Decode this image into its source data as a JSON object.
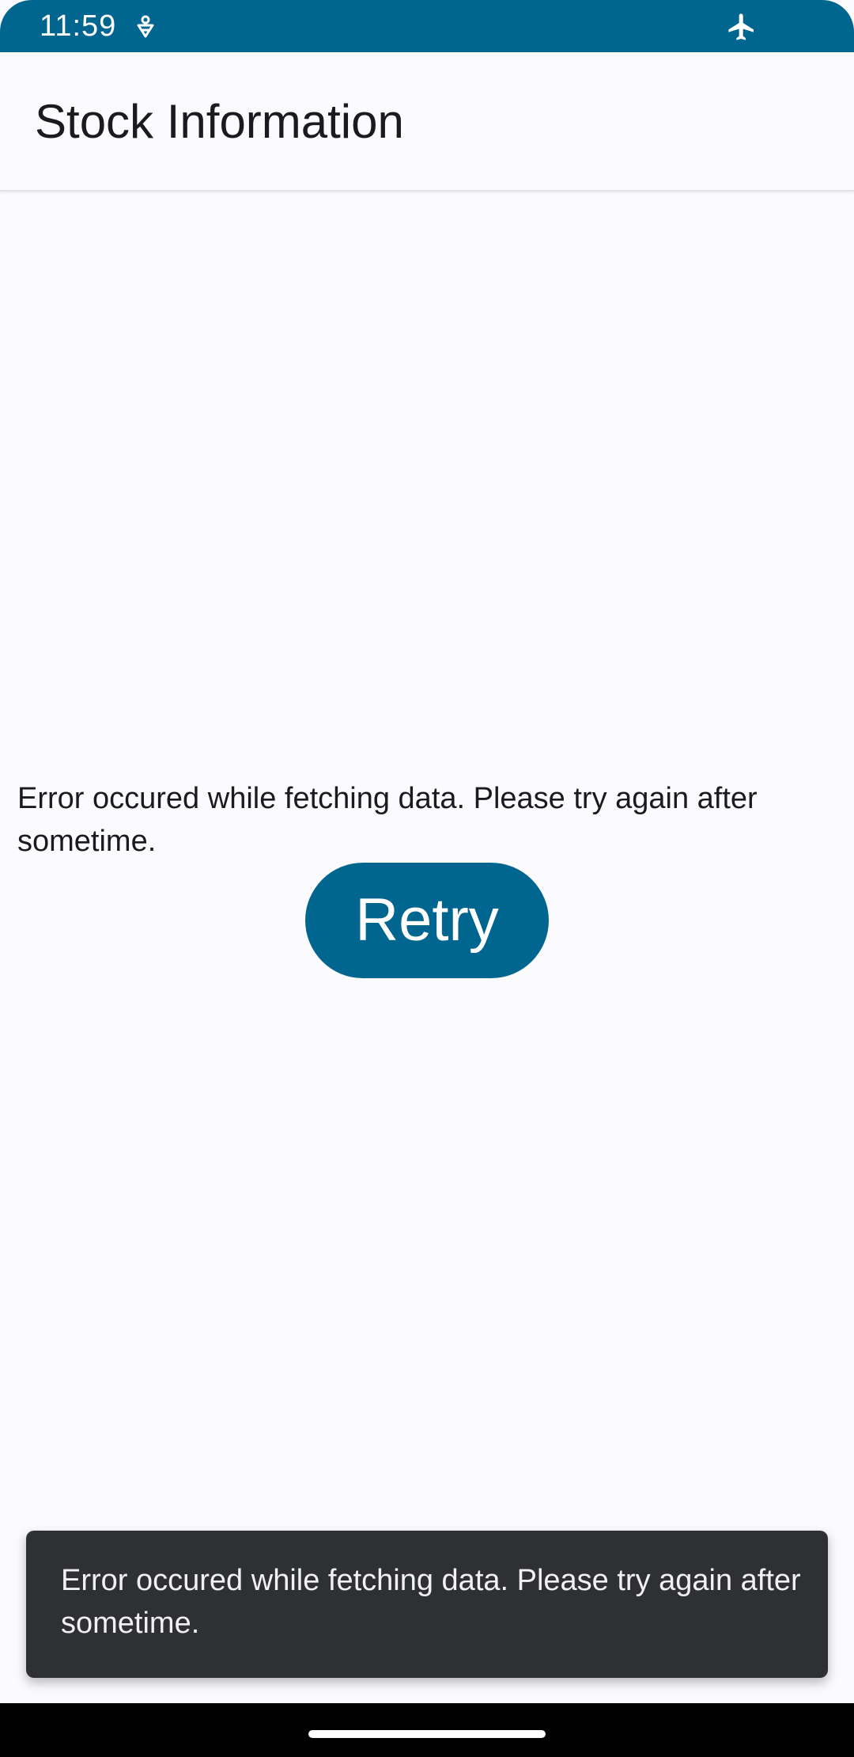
{
  "status_bar": {
    "time": "11:59",
    "icons": [
      "data-saver-icon",
      "airplane-mode-icon"
    ],
    "background_color": "#006690"
  },
  "app_bar": {
    "title": "Stock Information"
  },
  "main": {
    "error_message": "Error occured while fetching data. Please try again after sometime.",
    "retry_label": "Retry",
    "accent_color": "#006690"
  },
  "snackbar": {
    "message": "Error occured while fetching data. Please try again after sometime."
  },
  "nav_bar": {
    "icons": [
      "home-handle"
    ]
  }
}
